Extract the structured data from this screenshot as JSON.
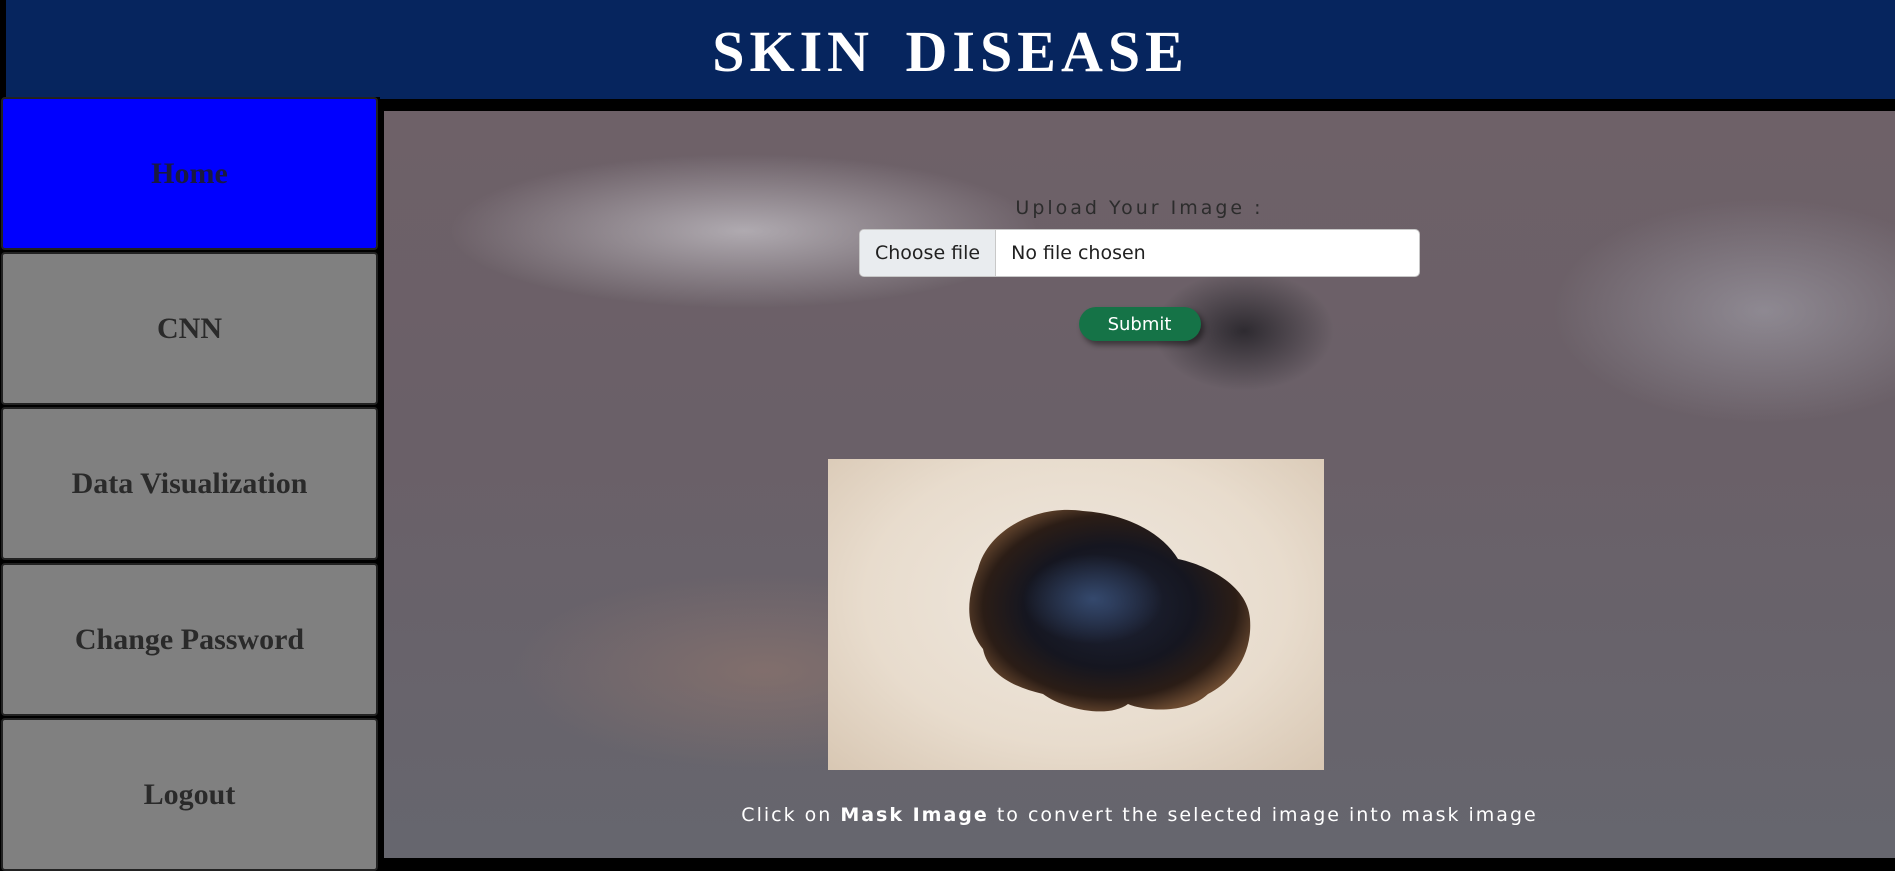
{
  "header": {
    "title": "SKIN DISEASE"
  },
  "sidebar": {
    "items": [
      {
        "label": "Home",
        "active": true
      },
      {
        "label": "CNN"
      },
      {
        "label": "Data Visualization"
      },
      {
        "label": "Change Password"
      },
      {
        "label": "Logout"
      }
    ]
  },
  "upload": {
    "label": "Upload Your Image :",
    "choose_file_label": "Choose file",
    "file_name": "No file chosen",
    "submit_label": "Submit"
  },
  "caption": {
    "prefix": "Click on",
    "emphasis": "Mask Image",
    "suffix": "to convert the selected image into mask image"
  },
  "colors": {
    "header_bg": "#06255e",
    "active_nav": "#0000ff",
    "nav_bg": "#808080",
    "submit_bg": "#157347"
  }
}
